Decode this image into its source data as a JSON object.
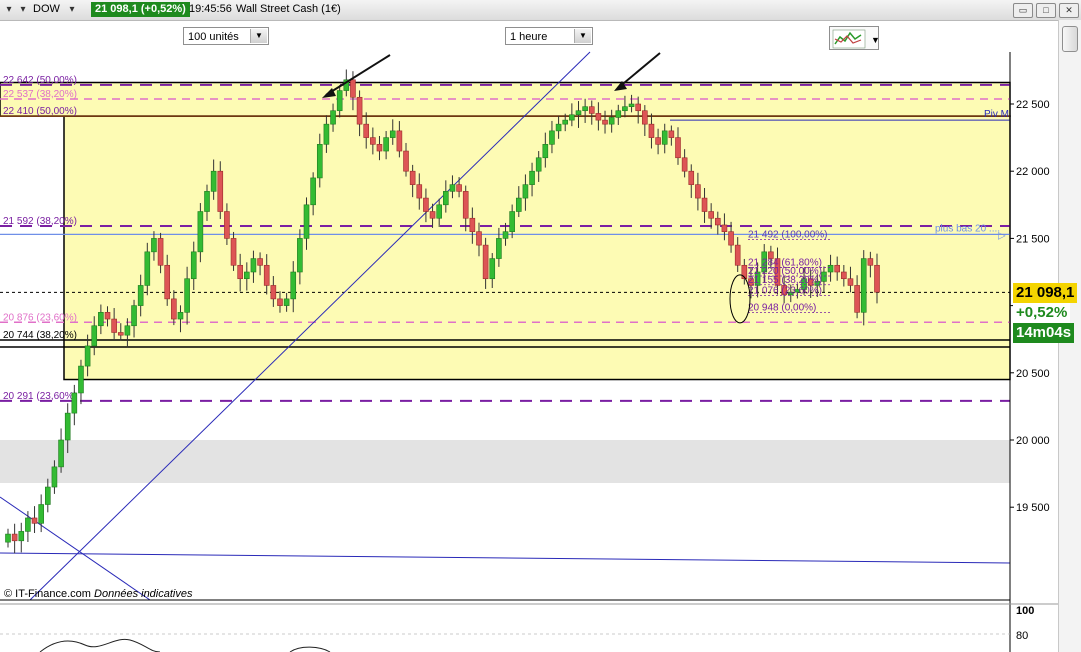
{
  "header": {
    "instrument": "DOW",
    "price_change": "21 098,1 (+0,52%)",
    "time": "19:45:56",
    "name": "Wall Street Cash (1€)"
  },
  "toolbar": {
    "quantity_select": "100 unités",
    "timeframe_select": "1 heure"
  },
  "price_panel": {
    "last_price": "21 098,1",
    "change_pct": "+0,52%",
    "countdown": "14m04s",
    "last_value": 21098.1
  },
  "credit": {
    "source": "© IT-Finance.com",
    "note": "Données indicatives"
  },
  "colors": {
    "up": "#33bb33",
    "down": "#dd5555",
    "zone": "#fdfbb4",
    "fib_purple": "#7a1fa2",
    "fib_pink": "#e070c8",
    "trend": "#2a2ab8",
    "resistance": "#7a3b10",
    "pivot": "#3a5bd8",
    "price_badge": "#1e8a1e"
  },
  "chart_data": {
    "type": "line",
    "title": "Wall Street Cash (1€)",
    "timeframe": "1 heure",
    "ylim": [
      19100,
      22800
    ],
    "yticks": [
      "22 500",
      "22 000",
      "21 500",
      "21 000",
      "20 500",
      "20 000",
      "19 500"
    ],
    "y_tick_values": [
      22500,
      22000,
      21500,
      21000,
      20500,
      20000,
      19500
    ],
    "last": 21098.1,
    "series": [
      {
        "values": [
          19300,
          19250,
          19320,
          19420,
          19380,
          19520,
          19650,
          19800,
          20000,
          20200,
          20350,
          20550,
          20700,
          20850,
          20950,
          20900,
          20800,
          20780,
          20850,
          21000,
          21150,
          21400,
          21500,
          21300,
          21050,
          20900,
          20950,
          21200,
          21400,
          21700,
          21850,
          22000,
          21700,
          21500,
          21300,
          21200,
          21250,
          21350,
          21300,
          21150,
          21050,
          21000,
          21050,
          21250,
          21500,
          21750,
          21950,
          22200,
          22350,
          22450,
          22600,
          22680,
          22550,
          22350,
          22250,
          22200,
          22150,
          22250,
          22300,
          22150,
          22000,
          21900,
          21800,
          21700,
          21650,
          21750,
          21850,
          21900,
          21850,
          21650,
          21550,
          21450,
          21200,
          21350,
          21500,
          21550,
          21700,
          21800,
          21900,
          22000,
          22100,
          22200,
          22300,
          22350,
          22380,
          22420,
          22450,
          22480,
          22430,
          22380,
          22350,
          22400,
          22450,
          22480,
          22500,
          22450,
          22350,
          22250,
          22200,
          22300,
          22250,
          22100,
          22000,
          21900,
          21800,
          21700,
          21650,
          21600,
          21550,
          21450,
          21300,
          21200,
          21150,
          21250,
          21400,
          21350,
          21150,
          21080,
          21100,
          21120,
          21200,
          21150,
          21180,
          21250,
          21300,
          21250,
          21200,
          21150,
          20950,
          21350,
          21300,
          21100
        ]
      }
    ],
    "horizontal_levels": [
      {
        "label": "22 642 (50,00%)",
        "value": 22642,
        "style": "purple-dash"
      },
      {
        "label": "22 537 (38,20%)",
        "value": 22537,
        "style": "pink-dash"
      },
      {
        "label": "22 410 (50,00%)",
        "value": 22410,
        "style": "brown-solid"
      },
      {
        "label": "21 592 (38,20%)",
        "value": 21592,
        "style": "purple-dash"
      },
      {
        "label": "20 876 (23,60%)",
        "value": 20876,
        "style": "pink-dash"
      },
      {
        "label": "20 744 (38,20%)",
        "value": 20744,
        "style": "black-solid"
      },
      {
        "label": "20 291 (23,60%)",
        "value": 20291,
        "style": "purple-dash"
      }
    ],
    "mini_fib_levels": [
      {
        "label": "21 492 (100,00%)",
        "value": 21492
      },
      {
        "label": "21 284 (61,80%)",
        "value": 21284
      },
      {
        "label": "21 220 (50,00%)",
        "value": 21220
      },
      {
        "label": "21 155 (38,20%)",
        "value": 21155
      },
      {
        "label": "21 076 (23,60%)",
        "value": 21076
      },
      {
        "label": "20 948 (0,00%)",
        "value": 20948
      }
    ],
    "annotations": [
      "Piv M",
      "plus bas 20 ...."
    ],
    "rsi_panel": {
      "ticks": [
        "100",
        "80"
      ]
    }
  }
}
